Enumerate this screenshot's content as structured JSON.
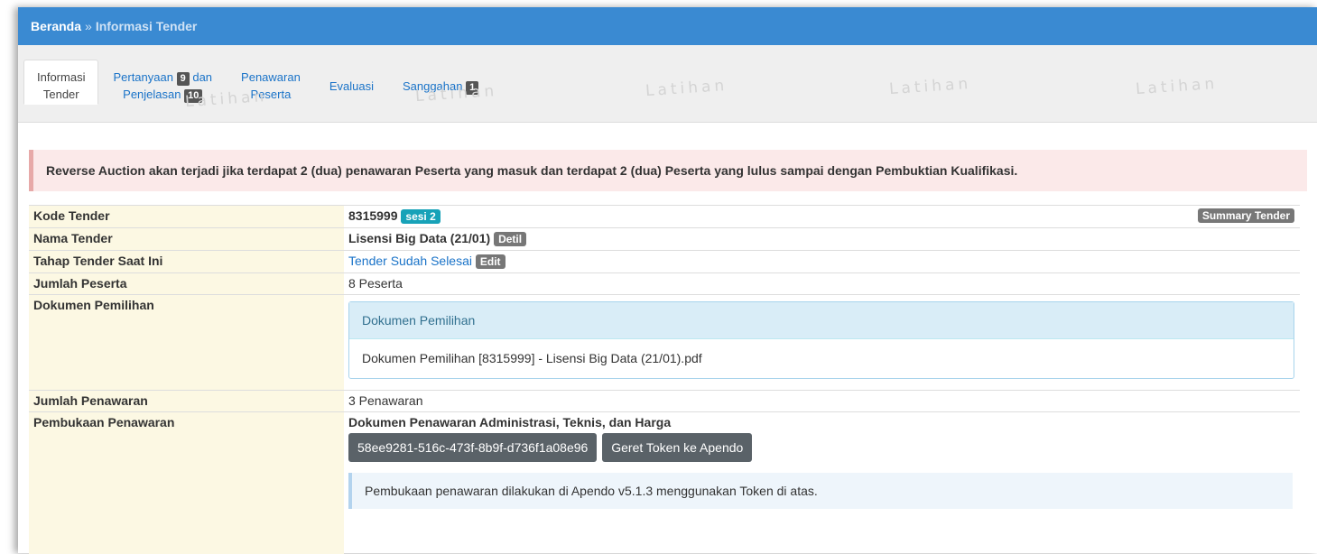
{
  "breadcrumb": {
    "home": "Beranda",
    "separator": "»",
    "current": "Informasi Tender"
  },
  "tabs": [
    {
      "line1": "Informasi",
      "line2": "Tender"
    },
    {
      "line1": "Pertanyaan",
      "badge1": "9",
      "line1b": "dan",
      "line2": "Penjelasan",
      "badge2": "10"
    },
    {
      "line1": "Penawaran",
      "line2": "Peserta"
    },
    {
      "label": "Evaluasi"
    },
    {
      "label": "Sanggahan",
      "badge": "1"
    }
  ],
  "watermark": "Latihan",
  "alert": "Reverse Auction akan terjadi jika terdapat 2 (dua) penawaran Peserta yang masuk dan terdapat 2 (dua) Peserta yang lulus sampai dengan Pembuktian Kualifikasi.",
  "rows": {
    "kode": {
      "label": "Kode Tender",
      "value": "8315999",
      "badge": "sesi 2",
      "action": "Summary Tender"
    },
    "nama": {
      "label": "Nama Tender",
      "value": "Lisensi Big Data (21/01)",
      "badge": "Detil"
    },
    "tahap": {
      "label": "Tahap Tender Saat Ini",
      "value": "Tender Sudah Selesai",
      "badge": "Edit"
    },
    "peserta": {
      "label": "Jumlah Peserta",
      "value": "8 Peserta"
    },
    "dokumen": {
      "label": "Dokumen Pemilihan",
      "panel_title": "Dokumen Pemilihan",
      "file": "Dokumen Pemilihan [8315999] - Lisensi Big Data (21/01).pdf"
    },
    "penawaran": {
      "label": "Jumlah Penawaran",
      "value": "3 Penawaran"
    },
    "pembukaan": {
      "label": "Pembukaan Penawaran",
      "title": "Dokumen Penawaran Administrasi, Teknis, dan Harga",
      "token": "58ee9281-516c-473f-8b9f-d736f1a08e96",
      "token_button": "Geret Token ke Apendo",
      "note": "Pembukaan penawaran dilakukan di Apendo v5.1.3 menggunakan Token di atas."
    }
  },
  "colors": {
    "header": "#3a8ad2",
    "label_bg": "#fcf8e3",
    "alert_bg": "#fbe9e9",
    "accent": "#1a73c8"
  }
}
